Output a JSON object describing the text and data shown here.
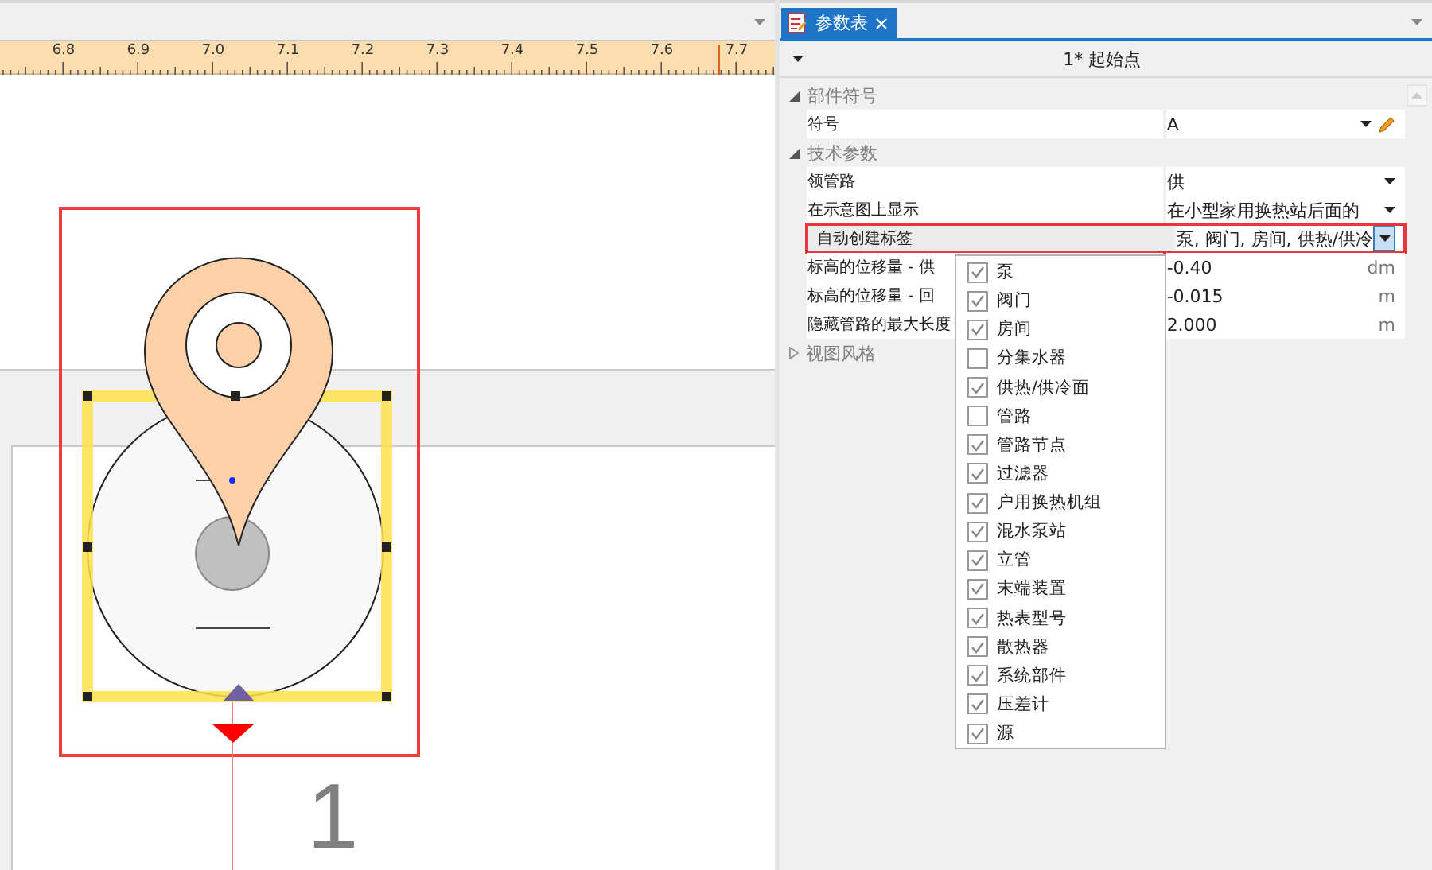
{
  "canvas": {
    "ruler_labels": [
      "6.8",
      "6.9",
      "7.0",
      "7.1",
      "7.2",
      "7.3",
      "7.4",
      "7.5",
      "7.6",
      "7.7"
    ],
    "sheet_number": "1"
  },
  "panel": {
    "tab": {
      "label": "参数表",
      "selected": true
    },
    "header": "1* 起始点",
    "groups": [
      {
        "title": "部件符号",
        "expanded": true,
        "rows": [
          {
            "label": "符号",
            "value": "A",
            "kind": "symbol",
            "selected": false
          }
        ]
      },
      {
        "title": "技术参数",
        "expanded": true,
        "rows": [
          {
            "label": "领管路",
            "value": "供",
            "kind": "dropdown",
            "selected": false
          },
          {
            "label": "在示意图上显示",
            "value": "在小型家用换热站后面的",
            "kind": "dropdown",
            "selected": false
          },
          {
            "label": "自动创建标签",
            "value": "泵, 阀门, 房间, 供热/供冷",
            "kind": "checklist",
            "selected": true
          },
          {
            "label": "标高的位移量 - 供",
            "value": "-0.40",
            "unit": "dm",
            "kind": "number",
            "selected": false
          },
          {
            "label": "标高的位移量 - 回",
            "value": "-0.015",
            "unit": "m",
            "kind": "number",
            "selected": false
          },
          {
            "label": "隐藏管路的最大长度",
            "value": "2.000",
            "unit": "m",
            "kind": "number",
            "selected": false
          }
        ]
      },
      {
        "title": "视图风格",
        "expanded": false
      }
    ]
  },
  "dropdown": {
    "items": [
      {
        "label": "泵",
        "checked": true
      },
      {
        "label": "阀门",
        "checked": true
      },
      {
        "label": "房间",
        "checked": true
      },
      {
        "label": "分集水器",
        "checked": false
      },
      {
        "label": "供热/供冷面",
        "checked": true
      },
      {
        "label": "管路",
        "checked": false
      },
      {
        "label": "管路节点",
        "checked": true
      },
      {
        "label": "过滤器",
        "checked": true
      },
      {
        "label": "户用换热机组",
        "checked": true
      },
      {
        "label": "混水泵站",
        "checked": true
      },
      {
        "label": "立管",
        "checked": true
      },
      {
        "label": "末端装置",
        "checked": true
      },
      {
        "label": "热表型号",
        "checked": true
      },
      {
        "label": "散热器",
        "checked": true
      },
      {
        "label": "系统部件",
        "checked": true
      },
      {
        "label": "压差计",
        "checked": true
      },
      {
        "label": "源",
        "checked": true
      }
    ]
  }
}
